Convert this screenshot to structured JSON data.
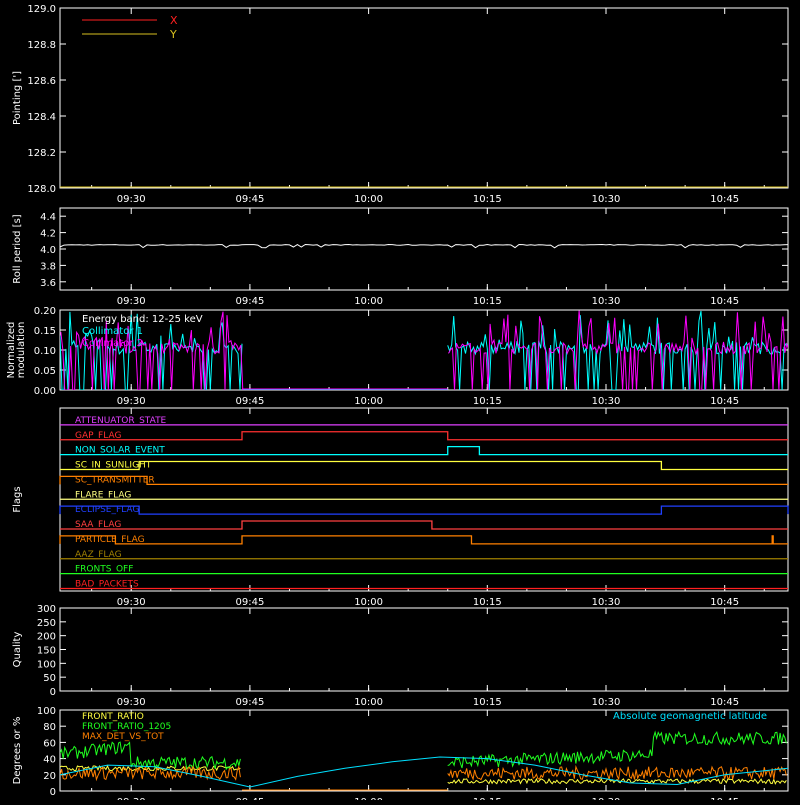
{
  "colors": {
    "background": "#000000",
    "axis": "#ffffff",
    "x_series": "#ff2020",
    "y_series": "#d8c020",
    "roll": "#ffffff",
    "collimator_1": "#00ffff",
    "collimator_2": "#ff00ff",
    "front_ratio": "#ffff40",
    "front_ratio_1205": "#20ff20",
    "max_det_vs_tot": "#ff8000",
    "geomag": "#00e0ff"
  },
  "time_axis": {
    "start": "09:21",
    "end": "10:53",
    "ticks": [
      "09:30",
      "09:45",
      "10:00",
      "10:15",
      "10:30",
      "10:45"
    ]
  },
  "chart_data": [
    {
      "id": "pointing",
      "type": "line",
      "ylabel": "Pointing [']",
      "ylim": [
        128.0,
        129.0
      ],
      "yticks": [
        "128.0",
        "128.2",
        "128.4",
        "128.6",
        "128.8",
        "129.0"
      ],
      "legend_position": "top-left",
      "series": [
        {
          "name": "X",
          "color_key": "x_series",
          "x": [
            "09:21",
            "10:53"
          ],
          "y": [
            128.0,
            128.0
          ]
        },
        {
          "name": "Y",
          "color_key": "y_series",
          "x": [
            "09:21",
            "10:53"
          ],
          "y": [
            128.0,
            128.0
          ]
        }
      ]
    },
    {
      "id": "roll",
      "type": "line",
      "ylabel": "Roll period [s]",
      "ylim": [
        3.5,
        4.5
      ],
      "yticks": [
        "3.6",
        "3.8",
        "4.0",
        "4.2",
        "4.4"
      ],
      "series": [
        {
          "name": "",
          "color_key": "roll",
          "x": [
            "09:21",
            "10:53"
          ],
          "y": [
            4.05,
            4.05
          ]
        }
      ]
    },
    {
      "id": "modulation",
      "type": "line",
      "ylabel": "Normalized modulation",
      "ylim": [
        0.0,
        0.2
      ],
      "yticks": [
        "0.00",
        "0.05",
        "0.10",
        "0.15",
        "0.20"
      ],
      "annotation": "Energy band: 12-25 keV",
      "legend_position": "top-left",
      "series": [
        {
          "name": "Collimator 1",
          "color_key": "collimator_1",
          "segments": [
            [
              "09:21",
              "09:44"
            ],
            [
              "10:10",
              "10:53"
            ]
          ],
          "baseline": 0.1
        },
        {
          "name": "Collimator 2",
          "color_key": "collimator_2",
          "segments": [
            [
              "09:21",
              "09:44"
            ],
            [
              "10:10",
              "10:53"
            ]
          ],
          "baseline": 0.1
        }
      ]
    },
    {
      "id": "flags",
      "type": "step",
      "ylabel": "Flags",
      "rows": [
        {
          "name": "ATTENUATOR_STATE",
          "color": "#e040ff",
          "lo": "09:21",
          "hi_intervals": []
        },
        {
          "name": "GAP_FLAG",
          "color": "#ff3030",
          "hi_intervals": [
            [
              "09:44",
              "10:10"
            ]
          ]
        },
        {
          "name": "NON_SOLAR_EVENT",
          "color": "#00ffff",
          "hi_intervals": [
            [
              "10:10",
              "10:14"
            ]
          ]
        },
        {
          "name": "SC_IN_SUNLIGHT",
          "color": "#ffff40",
          "hi_intervals": [
            [
              "09:31",
              "10:37"
            ]
          ]
        },
        {
          "name": "SC_TRANSMITTER",
          "color": "#ff8000",
          "hi_intervals": [
            [
              "09:21",
              "09:32"
            ]
          ]
        },
        {
          "name": "FLARE_FLAG",
          "color": "#ffff80",
          "hi_intervals": []
        },
        {
          "name": "ECLIPSE_FLAG",
          "color": "#2040ff",
          "hi_intervals": [
            [
              "09:21",
              "09:31"
            ],
            [
              "10:37",
              "10:53"
            ]
          ]
        },
        {
          "name": "SAA_FLAG",
          "color": "#ff4040",
          "hi_intervals": [
            [
              "09:44",
              "10:08"
            ]
          ]
        },
        {
          "name": "PARTICLE_FLAG",
          "color": "#ff8000",
          "hi_intervals": [
            [
              "09:21",
              "09:28"
            ],
            [
              "09:44",
              "10:13"
            ],
            [
              "10:51",
              "10:51"
            ]
          ]
        },
        {
          "name": "AAZ_FLAG",
          "color": "#a08000",
          "hi_intervals": []
        },
        {
          "name": "FRONTS_OFF",
          "color": "#20ff20",
          "hi_intervals": []
        },
        {
          "name": "BAD_PACKETS",
          "color": "#ff2020",
          "hi_intervals": []
        }
      ]
    },
    {
      "id": "quality",
      "type": "line",
      "ylabel": "Quality",
      "ylim": [
        0,
        300
      ],
      "yticks": [
        "0",
        "50",
        "100",
        "150",
        "200",
        "250",
        "300"
      ],
      "series": []
    },
    {
      "id": "ratios",
      "type": "line",
      "ylabel": "Degrees or %",
      "ylim": [
        0,
        100
      ],
      "yticks": [
        "0",
        "20",
        "40",
        "60",
        "80",
        "100"
      ],
      "legend_position": "top-left",
      "series": [
        {
          "name": "FRONT_RATIO",
          "color_key": "front_ratio",
          "segments": [
            [
              "09:21",
              "09:44"
            ],
            [
              "10:10",
              "10:53"
            ]
          ],
          "level": [
            28,
            12
          ]
        },
        {
          "name": "FRONT_RATIO_1205",
          "color_key": "front_ratio_1205",
          "segments": [
            [
              "09:21",
              "09:44"
            ],
            [
              "10:10",
              "10:53"
            ]
          ],
          "level": [
            40,
            60
          ]
        },
        {
          "name": "MAX_DET_VS_TOT",
          "color_key": "max_det_vs_tot",
          "segments": [
            [
              "09:21",
              "09:44"
            ],
            [
              "10:10",
              "10:53"
            ]
          ],
          "level": [
            22,
            22
          ]
        },
        {
          "name": "Absolute geomagnetic latitude",
          "color_key": "geomag",
          "x": [
            "09:21",
            "09:27",
            "09:33",
            "09:39",
            "09:45",
            "09:51",
            "09:57",
            "10:03",
            "10:09",
            "10:15",
            "10:21",
            "10:27",
            "10:33",
            "10:39",
            "10:45",
            "10:53"
          ],
          "y": [
            20,
            32,
            30,
            18,
            5,
            18,
            28,
            36,
            42,
            40,
            32,
            20,
            10,
            8,
            20,
            28
          ]
        }
      ]
    }
  ]
}
